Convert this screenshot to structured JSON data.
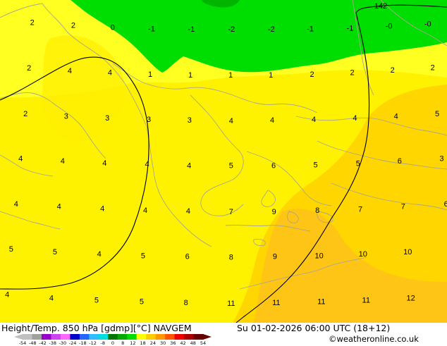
{
  "title_left": "Height/Temp. 850 hPa [gdmp][°C] NAVGEM",
  "title_right": "Su 01-02-2026 06:00 UTC (18+12)",
  "credit": "©weatheronline.co.uk",
  "contour_label": "142",
  "colorbar_ticks": [
    "-54",
    "-48",
    "-42",
    "-38",
    "-30",
    "-24",
    "-18",
    "-12",
    "-8",
    "0",
    "8",
    "12",
    "18",
    "24",
    "30",
    "36",
    "42",
    "48",
    "54"
  ],
  "colorbar_colors": [
    "#c0c0c0",
    "#a0a0a0",
    "#9900cc",
    "#cc44ee",
    "#ff66ff",
    "#0000cc",
    "#2266ff",
    "#33bbff",
    "#00dddd",
    "#007700",
    "#00aa00",
    "#00dd00",
    "#ffff00",
    "#ffcc00",
    "#ff9900",
    "#ff5500",
    "#ee0000",
    "#aa0000",
    "#660000"
  ],
  "colors": {
    "green": "#00dd00",
    "yellow_light": "#ffff22",
    "yellow": "#fff200",
    "gold": "#ffd200",
    "orange": "#ffbb22",
    "land_border": "#aaa88a",
    "contour": "#000000"
  },
  "temps": [
    [
      "2",
      "0.072",
      "0.069"
    ],
    [
      "2",
      "0.164",
      "0.078"
    ],
    [
      "0",
      "0.252",
      "0.084"
    ],
    [
      "-1",
      "0.339",
      "0.088"
    ],
    [
      "-1",
      "0.428",
      "0.090"
    ],
    [
      "-2",
      "0.518",
      "0.090"
    ],
    [
      "-2",
      "0.607",
      "0.090"
    ],
    [
      "-1",
      "0.694",
      "0.088"
    ],
    [
      "-1",
      "0.783",
      "0.086"
    ],
    [
      "-0",
      "0.870",
      "0.080"
    ],
    [
      "-0",
      "0.957",
      "0.073"
    ],
    [
      "2",
      "0.065",
      "0.210"
    ],
    [
      "4",
      "0.156",
      "0.218"
    ],
    [
      "4",
      "0.246",
      "0.224"
    ],
    [
      "1",
      "0.336",
      "0.229"
    ],
    [
      "1",
      "0.426",
      "0.231"
    ],
    [
      "1",
      "0.516",
      "0.231"
    ],
    [
      "1",
      "0.606",
      "0.231"
    ],
    [
      "2",
      "0.698",
      "0.229"
    ],
    [
      "2",
      "0.788",
      "0.224"
    ],
    [
      "2",
      "0.878",
      "0.216"
    ],
    [
      "2",
      "0.968",
      "0.208"
    ],
    [
      "2",
      "0.057",
      "0.351"
    ],
    [
      "3",
      "0.148",
      "0.359"
    ],
    [
      "3",
      "0.240",
      "0.365"
    ],
    [
      "3",
      "0.333",
      "0.369"
    ],
    [
      "3",
      "0.424",
      "0.371"
    ],
    [
      "4",
      "0.517",
      "0.373"
    ],
    [
      "4",
      "0.609",
      "0.371"
    ],
    [
      "4",
      "0.702",
      "0.369"
    ],
    [
      "4",
      "0.794",
      "0.365"
    ],
    [
      "4",
      "0.886",
      "0.359"
    ],
    [
      "5",
      "0.978",
      "0.351"
    ],
    [
      "4",
      "0.046",
      "0.490"
    ],
    [
      "4",
      "0.140",
      "0.498"
    ],
    [
      "4",
      "0.234",
      "0.504"
    ],
    [
      "4",
      "0.329",
      "0.508"
    ],
    [
      "4",
      "0.423",
      "0.512"
    ],
    [
      "5",
      "0.517",
      "0.512"
    ],
    [
      "6",
      "0.612",
      "0.512"
    ],
    [
      "5",
      "0.706",
      "0.510"
    ],
    [
      "5",
      "0.801",
      "0.506"
    ],
    [
      "6",
      "0.894",
      "0.498"
    ],
    [
      "3",
      "0.988",
      "0.490"
    ],
    [
      "4",
      "0.036",
      "0.631"
    ],
    [
      "4",
      "0.132",
      "0.639"
    ],
    [
      "4",
      "0.229",
      "0.645"
    ],
    [
      "4",
      "0.325",
      "0.651"
    ],
    [
      "4",
      "0.421",
      "0.653"
    ],
    [
      "7",
      "0.517",
      "0.655"
    ],
    [
      "9",
      "0.613",
      "0.655"
    ],
    [
      "8",
      "0.710",
      "0.651"
    ],
    [
      "7",
      "0.806",
      "0.647"
    ],
    [
      "7",
      "0.902",
      "0.639"
    ],
    [
      "6",
      "0.998",
      "0.631"
    ],
    [
      "5",
      "0.025",
      "0.771"
    ],
    [
      "5",
      "0.123",
      "0.780"
    ],
    [
      "4",
      "0.222",
      "0.786"
    ],
    [
      "5",
      "0.320",
      "0.792"
    ],
    [
      "6",
      "0.419",
      "0.794"
    ],
    [
      "8",
      "0.517",
      "0.796"
    ],
    [
      "9",
      "0.615",
      "0.794"
    ],
    [
      "10",
      "0.714",
      "0.792"
    ],
    [
      "10",
      "0.812",
      "0.786"
    ],
    [
      "10",
      "0.912",
      "0.780"
    ],
    [
      "4",
      "0.016",
      "0.912"
    ],
    [
      "4",
      "0.115",
      "0.922"
    ],
    [
      "5",
      "0.216",
      "0.929"
    ],
    [
      "5",
      "0.317",
      "0.933"
    ],
    [
      "8",
      "0.416",
      "0.937"
    ],
    [
      "11",
      "0.517",
      "0.939"
    ],
    [
      "11",
      "0.618",
      "0.937"
    ],
    [
      "11",
      "0.719",
      "0.933"
    ],
    [
      "11",
      "0.819",
      "0.929"
    ],
    [
      "12",
      "0.919",
      "0.922"
    ]
  ]
}
